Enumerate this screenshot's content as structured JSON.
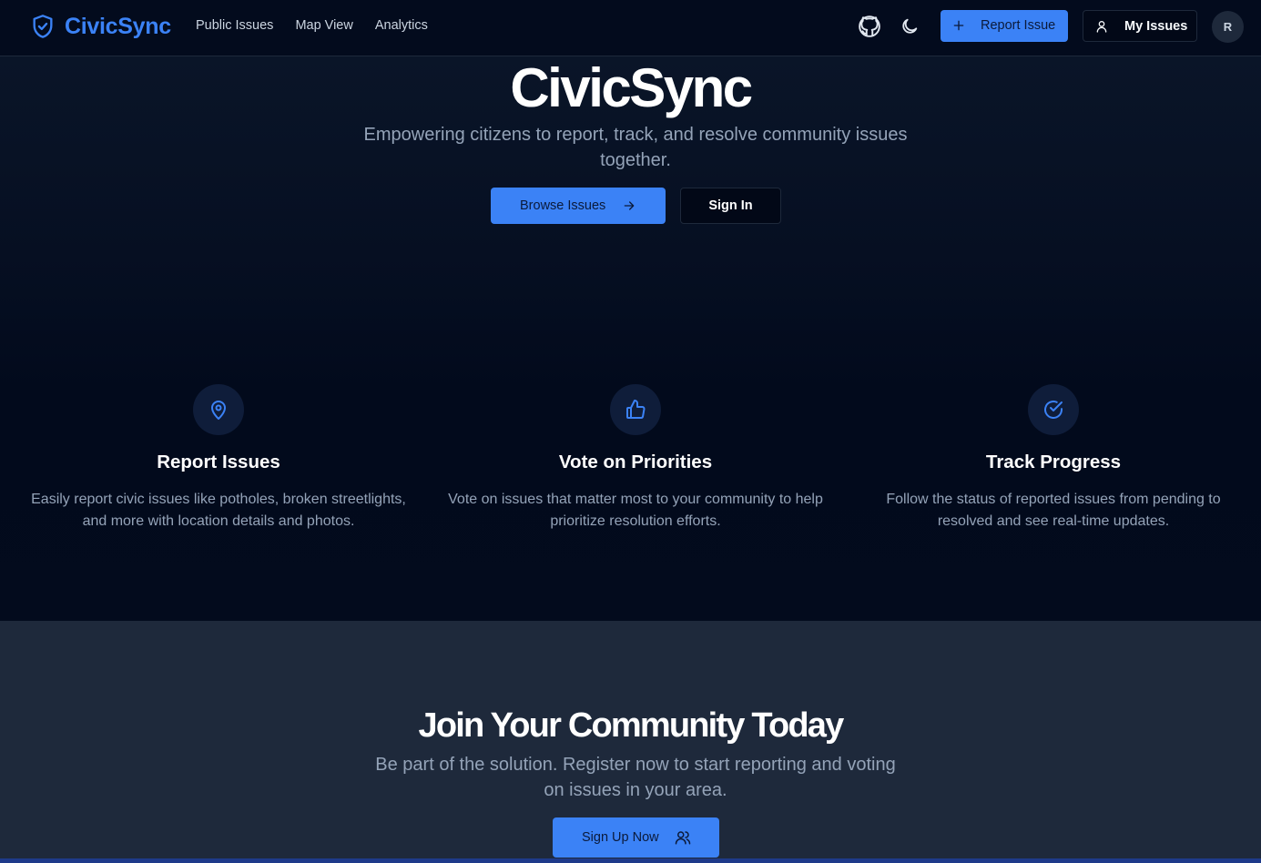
{
  "nav": {
    "brand": "CivicSync",
    "links": [
      "Public Issues",
      "Map View",
      "Analytics"
    ],
    "report_label": "Report Issue",
    "my_issues_label": "My Issues",
    "avatar_initial": "R"
  },
  "hero": {
    "title": "CivicSync",
    "subtitle": "Empowering citizens to report, track, and resolve community issues together.",
    "browse_label": "Browse Issues",
    "signin_label": "Sign In"
  },
  "features": [
    {
      "icon": "map-pin-icon",
      "title": "Report Issues",
      "desc": "Easily report civic issues like potholes, broken streetlights, and more with location details and photos."
    },
    {
      "icon": "thumbs-up-icon",
      "title": "Vote on Priorities",
      "desc": "Vote on issues that matter most to your community to help prioritize resolution efforts."
    },
    {
      "icon": "check-circle-icon",
      "title": "Track Progress",
      "desc": "Follow the status of reported issues from pending to resolved and see real-time updates."
    }
  ],
  "cta": {
    "title": "Join Your Community Today",
    "subtitle": "Be part of the solution. Register now to start reporting and voting on issues in your area.",
    "signup_label": "Sign Up Now"
  },
  "colors": {
    "accent": "#3b82f6",
    "background": "#020817",
    "cta_background": "#1e293b"
  }
}
